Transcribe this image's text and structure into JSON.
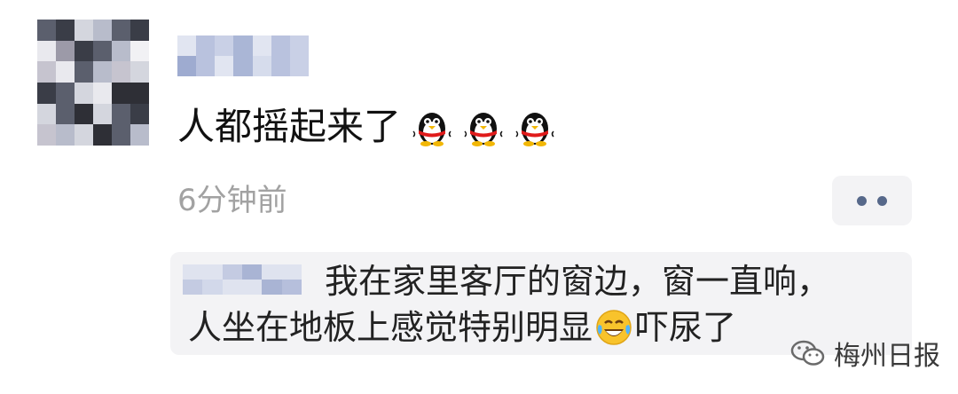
{
  "comment": {
    "text": "人都摇起来了",
    "emojis": [
      "penguin-emoji",
      "penguin-emoji",
      "penguin-emoji"
    ],
    "time": "6分钟前"
  },
  "actions": {
    "more_icon": "more-dots-icon"
  },
  "reply": {
    "line1": "我在家里客厅的窗边，窗一直响，",
    "line2_before": "人坐在地板上感觉特别明显",
    "emoji": "laugh-cry-emoji",
    "line2_after": "吓尿了"
  },
  "watermark": {
    "text": "梅州日报",
    "icon": "wechat-official-account-icon"
  },
  "colors": {
    "text": "#111111",
    "secondary": "#a2a2a2",
    "bubble": "#f3f3f5",
    "dots": "#56688a"
  }
}
